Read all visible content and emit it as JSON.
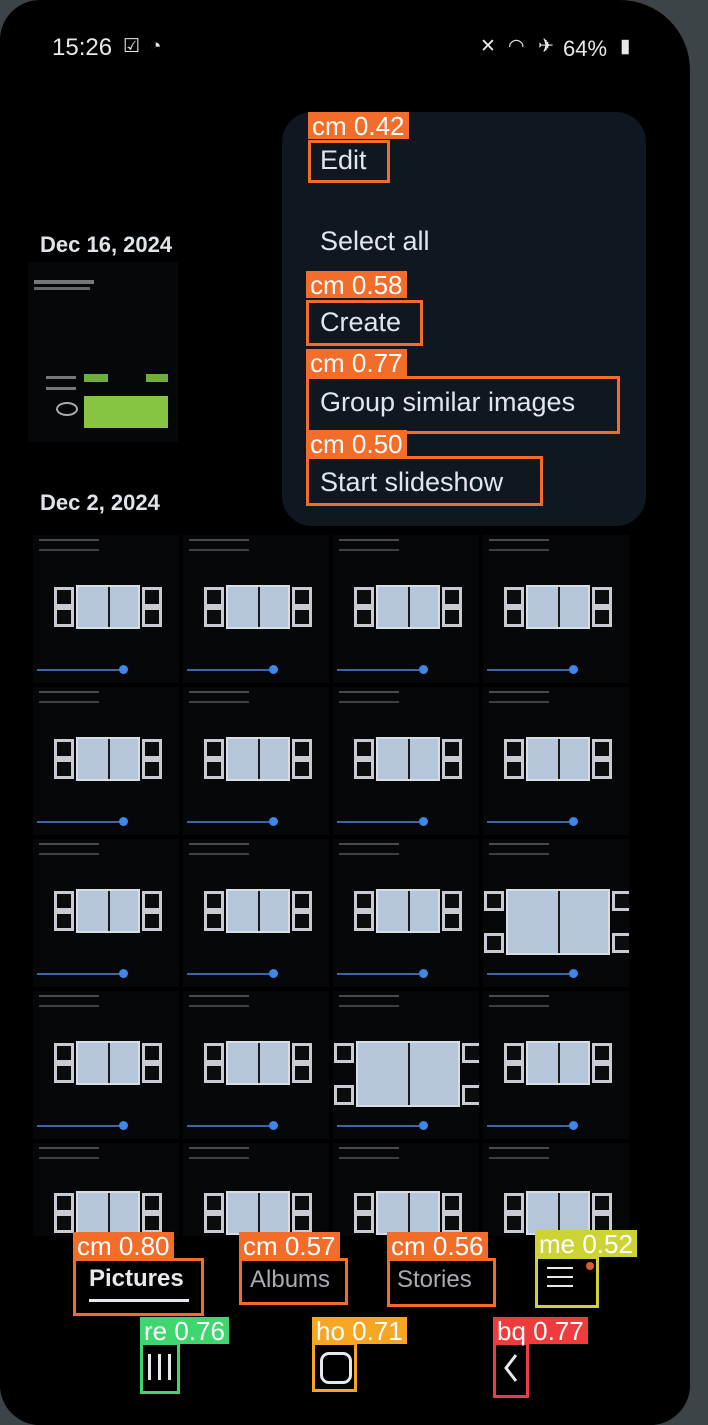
{
  "status_bar": {
    "time": "15:26",
    "battery": "64%"
  },
  "gallery": {
    "dates": [
      "Dec 16, 2024",
      "Dec 2, 2024"
    ]
  },
  "context_menu": {
    "items": [
      "Edit",
      "Select all",
      "Create",
      "Group similar images",
      "Start slideshow"
    ]
  },
  "bottom_tabs": {
    "pictures": "Pictures",
    "albums": "Albums",
    "stories": "Stories"
  },
  "annotations": [
    {
      "label": "cm",
      "score": "0.42",
      "color": "#f26d2a"
    },
    {
      "label": "cm",
      "score": "0.58",
      "color": "#f26d2a"
    },
    {
      "label": "cm",
      "score": "0.77",
      "color": "#f26d2a"
    },
    {
      "label": "cm",
      "score": "0.50",
      "color": "#f26d2a"
    },
    {
      "label": "cm",
      "score": "0.80",
      "color": "#f26d2a"
    },
    {
      "label": "cm",
      "score": "0.57",
      "color": "#f26d2a"
    },
    {
      "label": "cm",
      "score": "0.56",
      "color": "#f26d2a"
    },
    {
      "label": "me",
      "score": "0.52",
      "color": "#cdd335"
    },
    {
      "label": "re",
      "score": "0.76",
      "color": "#3fd66f"
    },
    {
      "label": "ho",
      "score": "0.71",
      "color": "#f6a623"
    },
    {
      "label": "bq",
      "score": "0.77",
      "color": "#ef3b3b"
    }
  ]
}
